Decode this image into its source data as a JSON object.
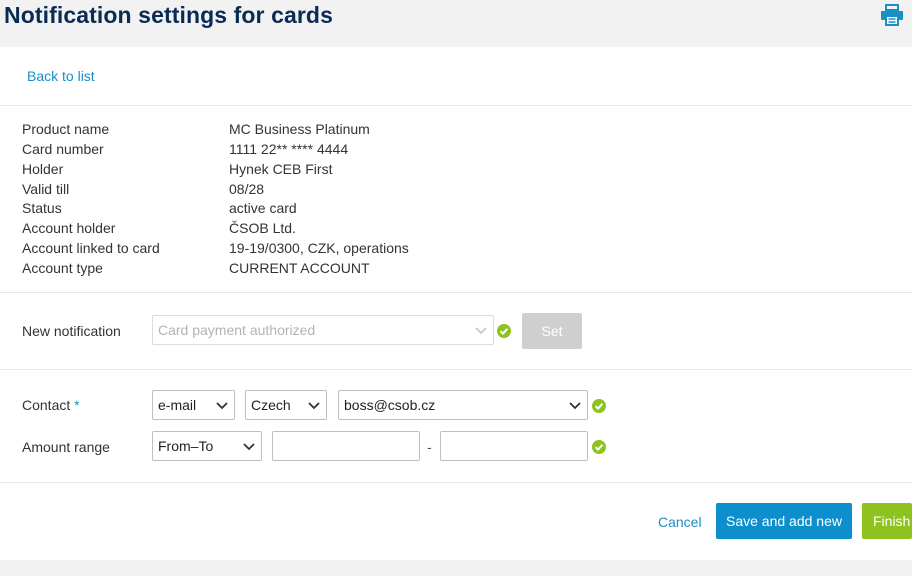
{
  "header": {
    "title": "Notification settings for cards"
  },
  "nav": {
    "back_label": "Back to list"
  },
  "card_info": [
    {
      "label": "Product name",
      "value": "MC Business Platinum"
    },
    {
      "label": "Card number",
      "value": "1111 22** **** 4444"
    },
    {
      "label": "Holder",
      "value": "Hynek CEB First"
    },
    {
      "label": "Valid till",
      "value": "08/28"
    },
    {
      "label": "Status",
      "value": "active card"
    },
    {
      "label": "Account holder",
      "value": "ČSOB Ltd."
    },
    {
      "label": "Account linked to card",
      "value": "19-19/0300, CZK, operations"
    },
    {
      "label": "Account type",
      "value": "CURRENT ACCOUNT"
    }
  ],
  "new_notification": {
    "label": "New notification",
    "selected": "Card payment authorized",
    "set_label": "Set"
  },
  "contact": {
    "label": "Contact",
    "required_mark": "*",
    "channel": "e-mail",
    "language": "Czech",
    "address": "boss@csob.cz"
  },
  "amount_range": {
    "label": "Amount range",
    "mode": "From–To",
    "from_value": "",
    "to_value": "",
    "separator": "-"
  },
  "actions": {
    "cancel_label": "Cancel",
    "save_add_label": "Save and add new",
    "finish_label": "Finish"
  },
  "colors": {
    "title": "#0a2b54",
    "link": "#1a8fc4",
    "primary_button": "#0e8fcd",
    "finish_button": "#8ec31f",
    "valid_check": "#8ec31f",
    "disabled_button": "#cfcfcf"
  },
  "icons": {
    "print": "printer-icon",
    "dropdown": "chevron-down-icon",
    "valid": "check-circle-icon"
  }
}
